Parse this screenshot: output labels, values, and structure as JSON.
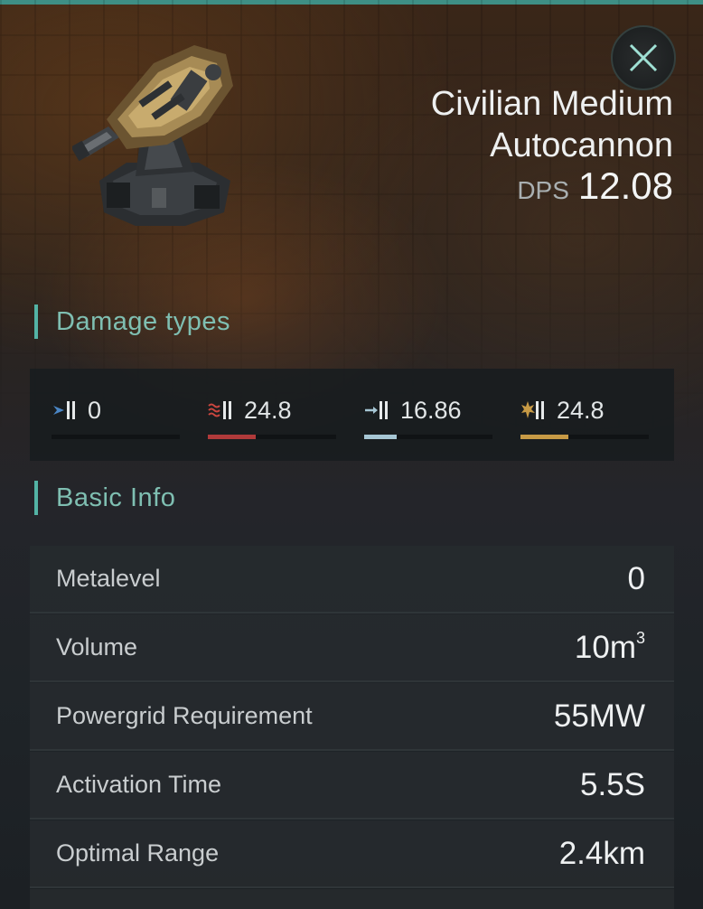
{
  "item": {
    "name_line1": "Civilian Medium",
    "name_line2": "Autocannon",
    "dps_label": "DPS",
    "dps_value": "12.08"
  },
  "icons": {
    "close": "close-icon",
    "item": "autocannon-turret-image",
    "em": "em-damage-icon",
    "thermal": "thermal-damage-icon",
    "kinetic": "kinetic-damage-icon",
    "explosive": "explosive-damage-icon"
  },
  "sections": {
    "damage_types": "Damage types",
    "basic_info": "Basic Info"
  },
  "damage": [
    {
      "type": "em",
      "value": "0",
      "fill_fraction": 0.0,
      "color": "#4a86c5"
    },
    {
      "type": "thermal",
      "value": "24.8",
      "fill_fraction": 0.37,
      "color": "#b03a3a"
    },
    {
      "type": "kinetic",
      "value": "16.86",
      "fill_fraction": 0.25,
      "color": "#a6c6d4"
    },
    {
      "type": "explosive",
      "value": "24.8",
      "fill_fraction": 0.37,
      "color": "#c79a45"
    }
  ],
  "basic_info": [
    {
      "label": "Metalevel",
      "value": "0"
    },
    {
      "label": "Volume",
      "value": "10m",
      "sup": "3"
    },
    {
      "label": "Powergrid Requirement",
      "value": "55MW"
    },
    {
      "label": "Activation Time",
      "value": "5.5S"
    },
    {
      "label": "Optimal Range",
      "value": "2.4km"
    }
  ],
  "colors": {
    "accent": "#53b3a5",
    "section_title": "#7fbfb2"
  }
}
